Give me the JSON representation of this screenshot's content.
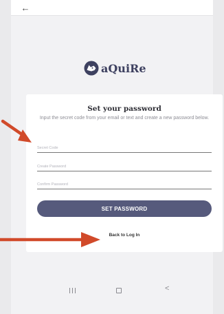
{
  "colors": {
    "accent": "#565a7c",
    "annotation_arrow": "#d14a2a",
    "brand_text": "#3e4160"
  },
  "topbar": {
    "back_icon": "arrow-left-icon",
    "back_glyph": "←"
  },
  "brand": {
    "name": "aQuiRe",
    "logo_icon": "fox-head-logo-icon"
  },
  "form": {
    "title": "Set your password",
    "description": "Input the secret code from your email or text and create a new password below.",
    "fields": [
      {
        "placeholder": "Secret Code",
        "value": ""
      },
      {
        "placeholder": "Create Password",
        "value": ""
      },
      {
        "placeholder": "Confirm Password",
        "value": ""
      }
    ],
    "submit_label": "SET PASSWORD",
    "back_link": "Back to Log In"
  },
  "navbar": {
    "recents_icon": "recents-icon",
    "home_icon": "home-icon",
    "back_icon": "back-chevron-icon",
    "back_glyph": "<"
  }
}
